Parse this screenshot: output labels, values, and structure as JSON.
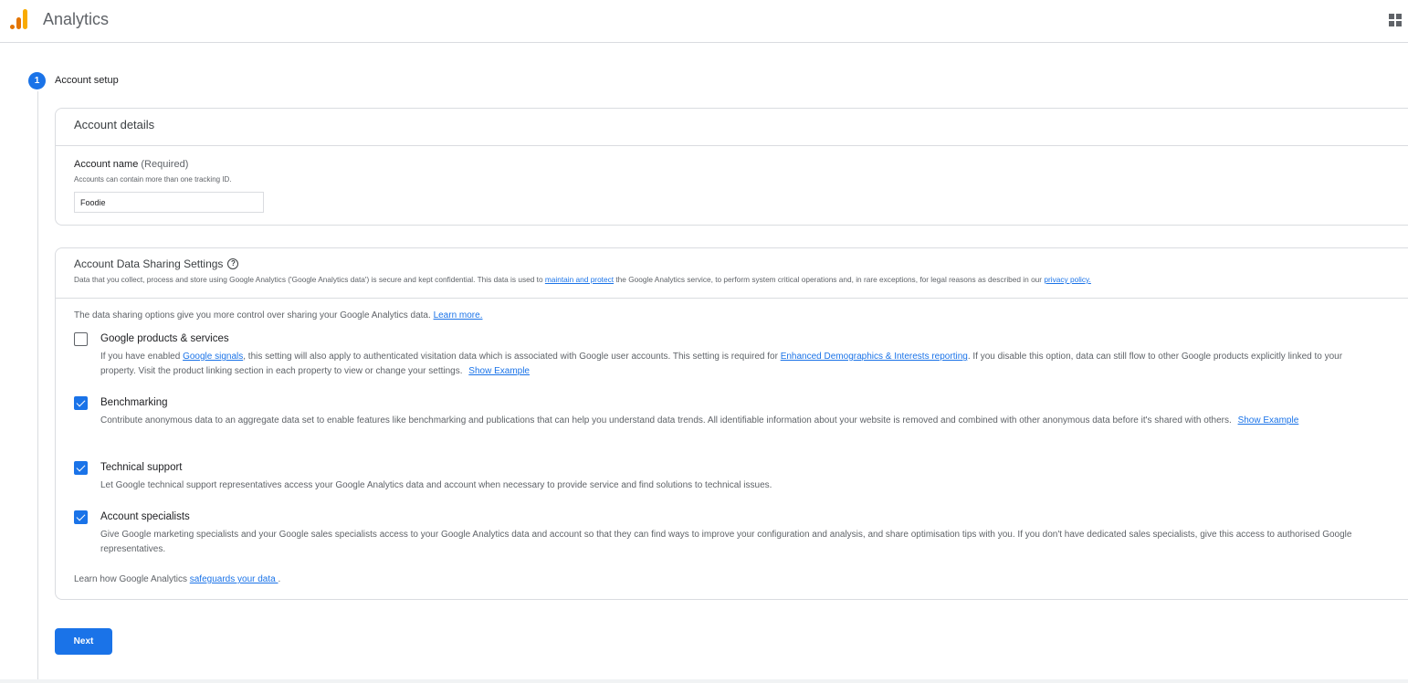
{
  "header": {
    "app_title": "Analytics",
    "logo_icon": "analytics-bars-icon",
    "apps_icon": "apps-grid-icon"
  },
  "stepper": {
    "step_number": "1",
    "step_label": "Account setup"
  },
  "account_details": {
    "title": "Account details",
    "field_label": "Account name",
    "field_required": "(Required)",
    "field_help": "Accounts can contain more than one tracking ID.",
    "field_value": "Foodie"
  },
  "data_sharing": {
    "title": "Account Data Sharing Settings",
    "help_icon": "help-circle-icon",
    "desc_prefix": "Data that you collect, process and store using Google Analytics ('Google Analytics data') is secure and kept confidential. This data is used to ",
    "desc_link1": "maintain and protect",
    "desc_middle": " the Google Analytics service, to perform system critical operations and, in rare exceptions, for legal reasons as described in our ",
    "desc_link2": "privacy policy.",
    "intro_text": "The data sharing options give you more control over sharing your Google Analytics data. ",
    "intro_link": "Learn more.",
    "options": [
      {
        "title": "Google products & services",
        "checked": false,
        "desc_prefix": "If you have enabled ",
        "link1": "Google signals",
        "desc_middle": ", this setting will also apply to authenticated visitation data which is associated with Google user accounts. This setting is required for ",
        "link2": "Enhanced Demographics & Interests reporting",
        "desc_suffix": ". If you disable this option, data can still flow to other Google products explicitly linked to your property. Visit the product linking section in each property to view or change your settings.",
        "show_example": "Show Example"
      },
      {
        "title": "Benchmarking",
        "checked": true,
        "desc": "Contribute anonymous data to an aggregate data set to enable features like benchmarking and publications that can help you understand data trends. All identifiable information about your website is removed and combined with other anonymous data before it's shared with others.",
        "show_example": "Show Example"
      },
      {
        "title": "Technical support",
        "checked": true,
        "desc": "Let Google technical support representatives access your Google Analytics data and account when necessary to provide service and find solutions to technical issues."
      },
      {
        "title": "Account specialists",
        "checked": true,
        "desc": "Give Google marketing specialists and your Google sales specialists access to your Google Analytics data and account so that they can find ways to improve your configuration and analysis, and share optimisation tips with you. If you don't have dedicated sales specialists, give this access to authorised Google representatives."
      }
    ],
    "footer_prefix": "Learn how Google Analytics ",
    "footer_link": "safeguards your data ",
    "footer_suffix": "."
  },
  "actions": {
    "next_label": "Next"
  },
  "colors": {
    "accent": "#1a73e8",
    "logo_orange": "#e37400",
    "logo_yellow": "#f9ab00"
  }
}
